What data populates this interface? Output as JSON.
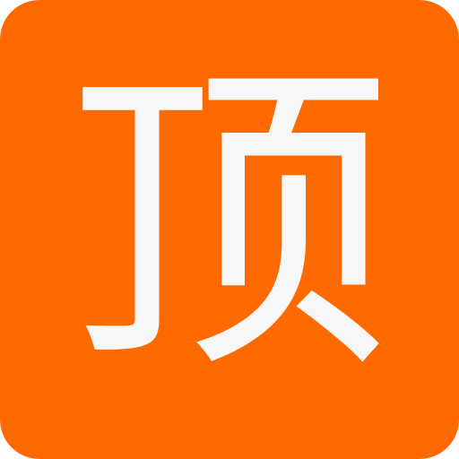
{
  "app_icon": {
    "glyph": "顶",
    "background_color": "#FF6A00",
    "glyph_color": "#F7F7F7"
  }
}
